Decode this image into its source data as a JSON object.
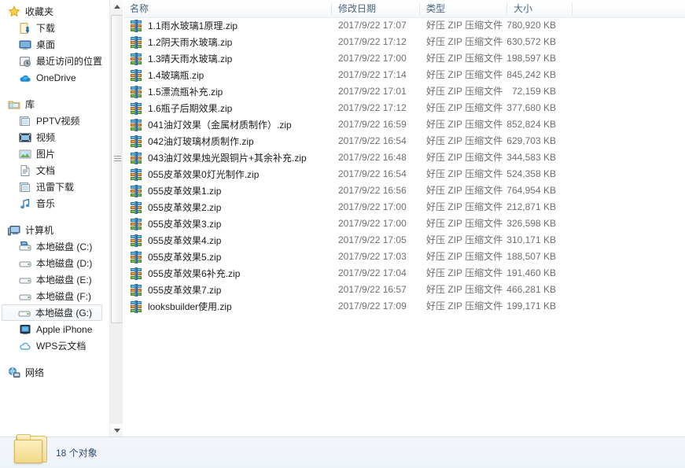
{
  "window": {
    "title": "",
    "status_text": "18 个对象",
    "status_icon": "folder-icon"
  },
  "nav": {
    "scrollbar": {
      "up": "scroll-up-arrow",
      "down": "scroll-down-arrow"
    },
    "groups": [
      {
        "header": {
          "label": "收藏夹",
          "icon": "star-icon"
        },
        "items": [
          {
            "label": "下载",
            "icon": "downloads-icon"
          },
          {
            "label": "桌面",
            "icon": "desktop-icon"
          },
          {
            "label": "最近访问的位置",
            "icon": "recent-places-icon"
          },
          {
            "label": "OneDrive",
            "icon": "onedrive-cloud-icon"
          }
        ]
      },
      {
        "header": {
          "label": "库",
          "icon": "library-icon"
        },
        "items": [
          {
            "label": "PPTV视频",
            "icon": "library-folder-icon"
          },
          {
            "label": "视频",
            "icon": "video-library-icon"
          },
          {
            "label": "图片",
            "icon": "pictures-library-icon"
          },
          {
            "label": "文档",
            "icon": "documents-library-icon"
          },
          {
            "label": "迅雷下载",
            "icon": "library-folder-icon"
          },
          {
            "label": "音乐",
            "icon": "music-note-icon"
          }
        ]
      },
      {
        "header": {
          "label": "计算机",
          "icon": "computer-icon"
        },
        "items": [
          {
            "label": "本地磁盘 (C:)",
            "icon": "system-drive-icon"
          },
          {
            "label": "本地磁盘 (D:)",
            "icon": "drive-icon"
          },
          {
            "label": "本地磁盘 (E:)",
            "icon": "drive-icon"
          },
          {
            "label": "本地磁盘 (F:)",
            "icon": "drive-icon"
          },
          {
            "label": "本地磁盘 (G:)",
            "icon": "drive-icon",
            "selected": true
          },
          {
            "label": "Apple iPhone",
            "icon": "portable-device-icon"
          },
          {
            "label": "WPS云文档",
            "icon": "wps-cloud-icon"
          }
        ]
      },
      {
        "header": {
          "label": "网络",
          "icon": "network-icon"
        },
        "items": []
      }
    ]
  },
  "list": {
    "columns": [
      {
        "key": "name",
        "label": "名称"
      },
      {
        "key": "date",
        "label": "修改日期"
      },
      {
        "key": "type",
        "label": "类型"
      },
      {
        "key": "size",
        "label": "大小"
      }
    ],
    "rows": [
      {
        "icon": "zip-file-icon",
        "name": "1.1雨水玻璃1原理.zip",
        "date": "2017/9/22 17:07",
        "type": "好压 ZIP 压缩文件",
        "size": "780,920 KB"
      },
      {
        "icon": "zip-file-icon",
        "name": "1.2阴天雨水玻璃.zip",
        "date": "2017/9/22 17:12",
        "type": "好压 ZIP 压缩文件",
        "size": "630,572 KB"
      },
      {
        "icon": "zip-file-icon",
        "name": "1.3晴天雨水玻璃.zip",
        "date": "2017/9/22 17:00",
        "type": "好压 ZIP 压缩文件",
        "size": "198,597 KB"
      },
      {
        "icon": "zip-file-icon",
        "name": "1.4玻璃瓶.zip",
        "date": "2017/9/22 17:14",
        "type": "好压 ZIP 压缩文件",
        "size": "845,242 KB"
      },
      {
        "icon": "zip-file-icon",
        "name": "1.5漂流瓶补充.zip",
        "date": "2017/9/22 17:01",
        "type": "好压 ZIP 压缩文件",
        "size": "72,159 KB"
      },
      {
        "icon": "zip-file-icon",
        "name": "1.6瓶子后期效果.zip",
        "date": "2017/9/22 17:12",
        "type": "好压 ZIP 压缩文件",
        "size": "377,680 KB"
      },
      {
        "icon": "zip-file-icon",
        "name": "041油灯效果（金属材质制作）.zip",
        "date": "2017/9/22 16:59",
        "type": "好压 ZIP 压缩文件",
        "size": "852,824 KB"
      },
      {
        "icon": "zip-file-icon",
        "name": "042油灯玻璃材质制作.zip",
        "date": "2017/9/22 16:54",
        "type": "好压 ZIP 压缩文件",
        "size": "629,703 KB"
      },
      {
        "icon": "zip-file-icon",
        "name": "043油灯效果烛光跟铜片+其余补充.zip",
        "date": "2017/9/22 16:48",
        "type": "好压 ZIP 压缩文件",
        "size": "344,583 KB"
      },
      {
        "icon": "zip-file-icon",
        "name": "055皮革效果0灯光制作.zip",
        "date": "2017/9/22 16:54",
        "type": "好压 ZIP 压缩文件",
        "size": "524,358 KB"
      },
      {
        "icon": "zip-file-icon",
        "name": "055皮革效果1.zip",
        "date": "2017/9/22 16:56",
        "type": "好压 ZIP 压缩文件",
        "size": "764,954 KB"
      },
      {
        "icon": "zip-file-icon",
        "name": "055皮革效果2.zip",
        "date": "2017/9/22 17:00",
        "type": "好压 ZIP 压缩文件",
        "size": "212,871 KB"
      },
      {
        "icon": "zip-file-icon",
        "name": "055皮革效果3.zip",
        "date": "2017/9/22 17:00",
        "type": "好压 ZIP 压缩文件",
        "size": "326,598 KB"
      },
      {
        "icon": "zip-file-icon",
        "name": "055皮革效果4.zip",
        "date": "2017/9/22 17:05",
        "type": "好压 ZIP 压缩文件",
        "size": "310,171 KB"
      },
      {
        "icon": "zip-file-icon",
        "name": "055皮革效果5.zip",
        "date": "2017/9/22 17:03",
        "type": "好压 ZIP 压缩文件",
        "size": "188,507 KB"
      },
      {
        "icon": "zip-file-icon",
        "name": "055皮革效果6补充.zip",
        "date": "2017/9/22 17:04",
        "type": "好压 ZIP 压缩文件",
        "size": "191,460 KB"
      },
      {
        "icon": "zip-file-icon",
        "name": "055皮革效果7.zip",
        "date": "2017/9/22 16:57",
        "type": "好压 ZIP 压缩文件",
        "size": "466,281 KB"
      },
      {
        "icon": "zip-file-icon",
        "name": "looksbuilder使用.zip",
        "date": "2017/9/22 17:09",
        "type": "好压 ZIP 压缩文件",
        "size": "199,171 KB"
      }
    ]
  },
  "colors": {
    "header_text": "#4a6480",
    "row_text": "#1e1e1e",
    "meta_text": "#6f6f6f",
    "status_text": "#2f4a6b"
  }
}
